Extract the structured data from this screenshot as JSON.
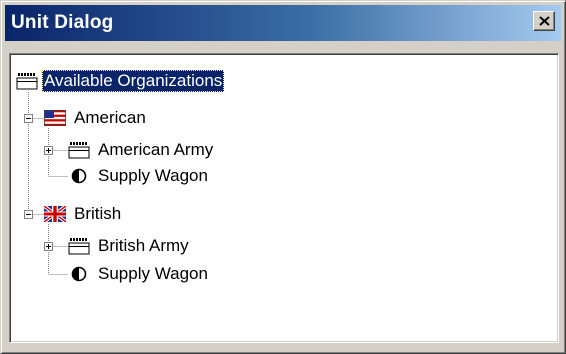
{
  "window": {
    "title": "Unit Dialog",
    "close_glyph": "close-icon"
  },
  "tree": {
    "root": {
      "label": "Available Organizations",
      "icon": "org-unit-icon",
      "selected": true
    },
    "american": {
      "label": "American",
      "icon": "us-flag-icon",
      "expanded": true,
      "army": {
        "label": "American Army",
        "icon": "org-unit-icon",
        "expanded": false
      },
      "wagon": {
        "label": "Supply Wagon",
        "icon": "half-circle-icon"
      }
    },
    "british": {
      "label": "British",
      "icon": "uk-flag-icon",
      "expanded": true,
      "army": {
        "label": "British Army",
        "icon": "org-unit-icon",
        "expanded": false
      },
      "wagon": {
        "label": "Supply Wagon",
        "icon": "half-circle-icon"
      }
    }
  },
  "colors": {
    "titlebar_start": "#0a246a",
    "titlebar_end": "#a6caf0",
    "selection": "#0a246a",
    "face": "#d4d0c8"
  }
}
